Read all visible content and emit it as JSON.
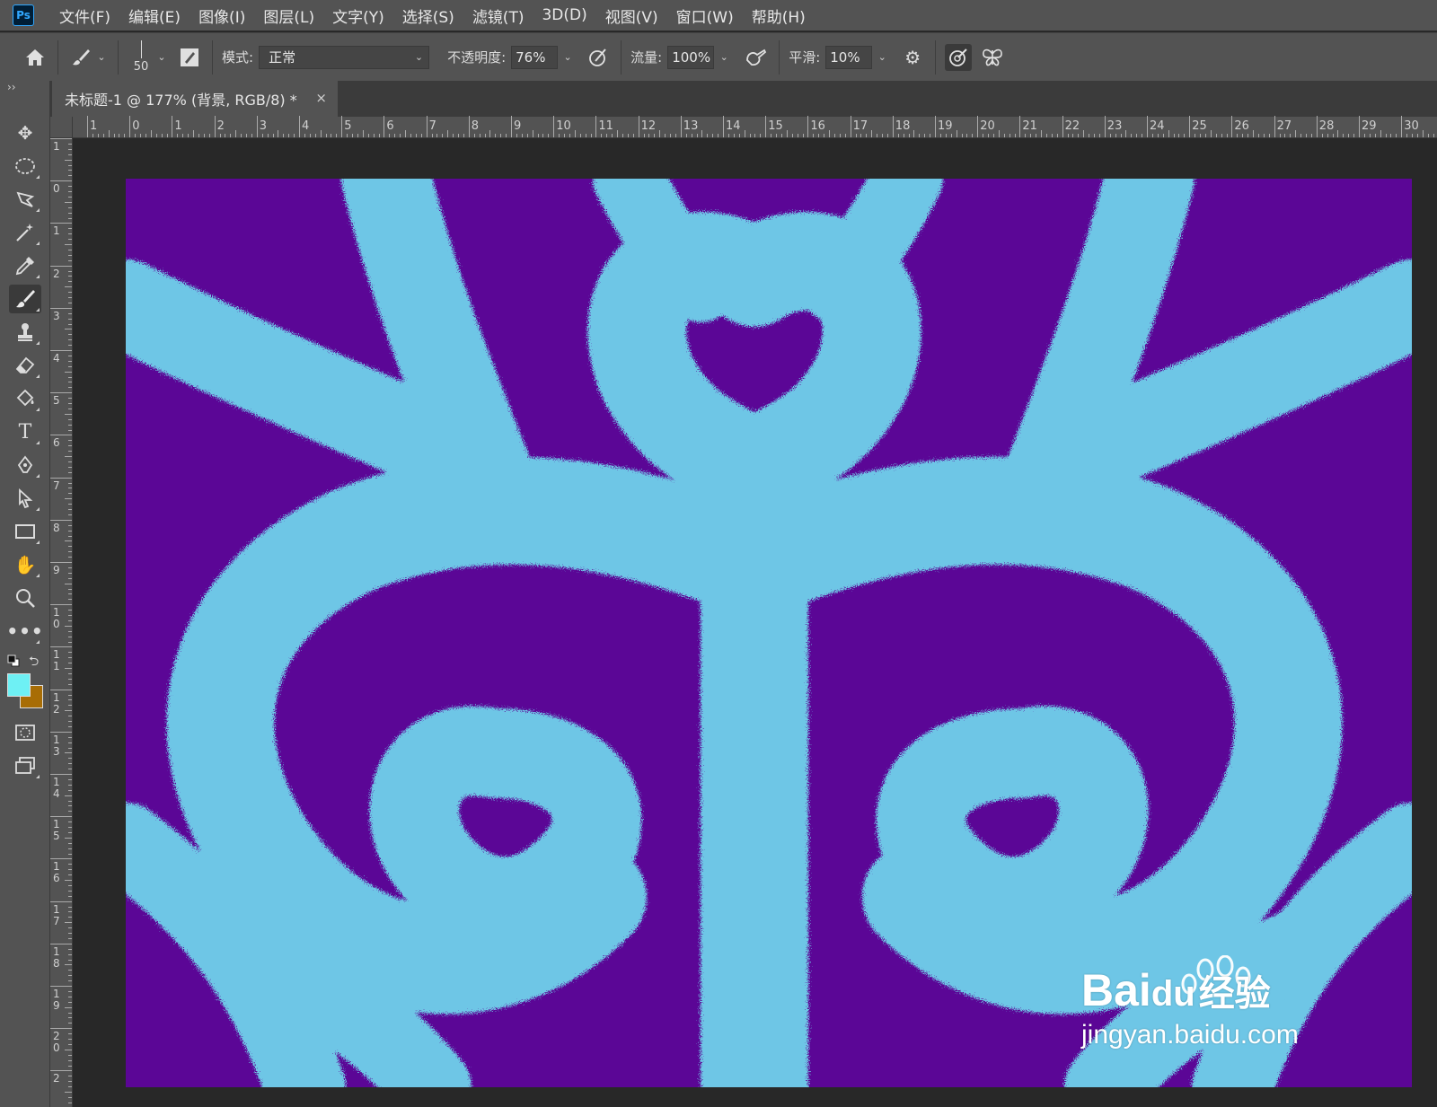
{
  "menu": [
    "文件(F)",
    "编辑(E)",
    "图像(I)",
    "图层(L)",
    "文字(Y)",
    "选择(S)",
    "滤镜(T)",
    "3D(D)",
    "视图(V)",
    "窗口(W)",
    "帮助(H)"
  ],
  "app_logo": "Ps",
  "options": {
    "brush_size": "50",
    "mode_label": "模式:",
    "mode_value": "正常",
    "opacity_label": "不透明度:",
    "opacity_value": "76%",
    "flow_label": "流量:",
    "flow_value": "100%",
    "smoothing_label": "平滑:",
    "smoothing_value": "10%"
  },
  "document_tab": {
    "title": "未标题-1 @ 177% (背景, RGB/8) *",
    "close": "×"
  },
  "ruler": {
    "top_ticks": [
      "1",
      "0",
      "1",
      "2",
      "3",
      "4",
      "5",
      "6",
      "7",
      "8",
      "9",
      "10",
      "11",
      "12",
      "13",
      "14",
      "15",
      "16",
      "17",
      "18",
      "19",
      "20",
      "21",
      "22",
      "23",
      "24",
      "25",
      "26",
      "27",
      "28",
      "29",
      "30"
    ],
    "left_ticks": [
      "1",
      "0",
      "1",
      "2",
      "3",
      "4",
      "5",
      "6",
      "7",
      "8",
      "9",
      "10",
      "11",
      "12",
      "13",
      "14",
      "15",
      "16",
      "17",
      "18",
      "19",
      "20",
      "2"
    ]
  },
  "colors": {
    "foreground": "#6ef0f4",
    "background": "#a86d05",
    "canvas_purple": "#5b0696",
    "canvas_cyan": "#6ec6e6"
  },
  "toolbar_icons": [
    "move-icon",
    "elliptical-marquee-icon",
    "lasso-icon",
    "magic-wand-icon",
    "eyedropper-icon",
    "brush-icon",
    "clone-stamp-icon",
    "eraser-icon",
    "paint-bucket-icon",
    "type-icon",
    "pen-icon",
    "path-selection-icon",
    "rectangle-icon",
    "hand-icon",
    "zoom-icon",
    "more-tools-icon"
  ],
  "watermark": {
    "brand": "Bai",
    "brand2": "du",
    "suffix": "经验",
    "url": "jingyan.baidu.com"
  }
}
